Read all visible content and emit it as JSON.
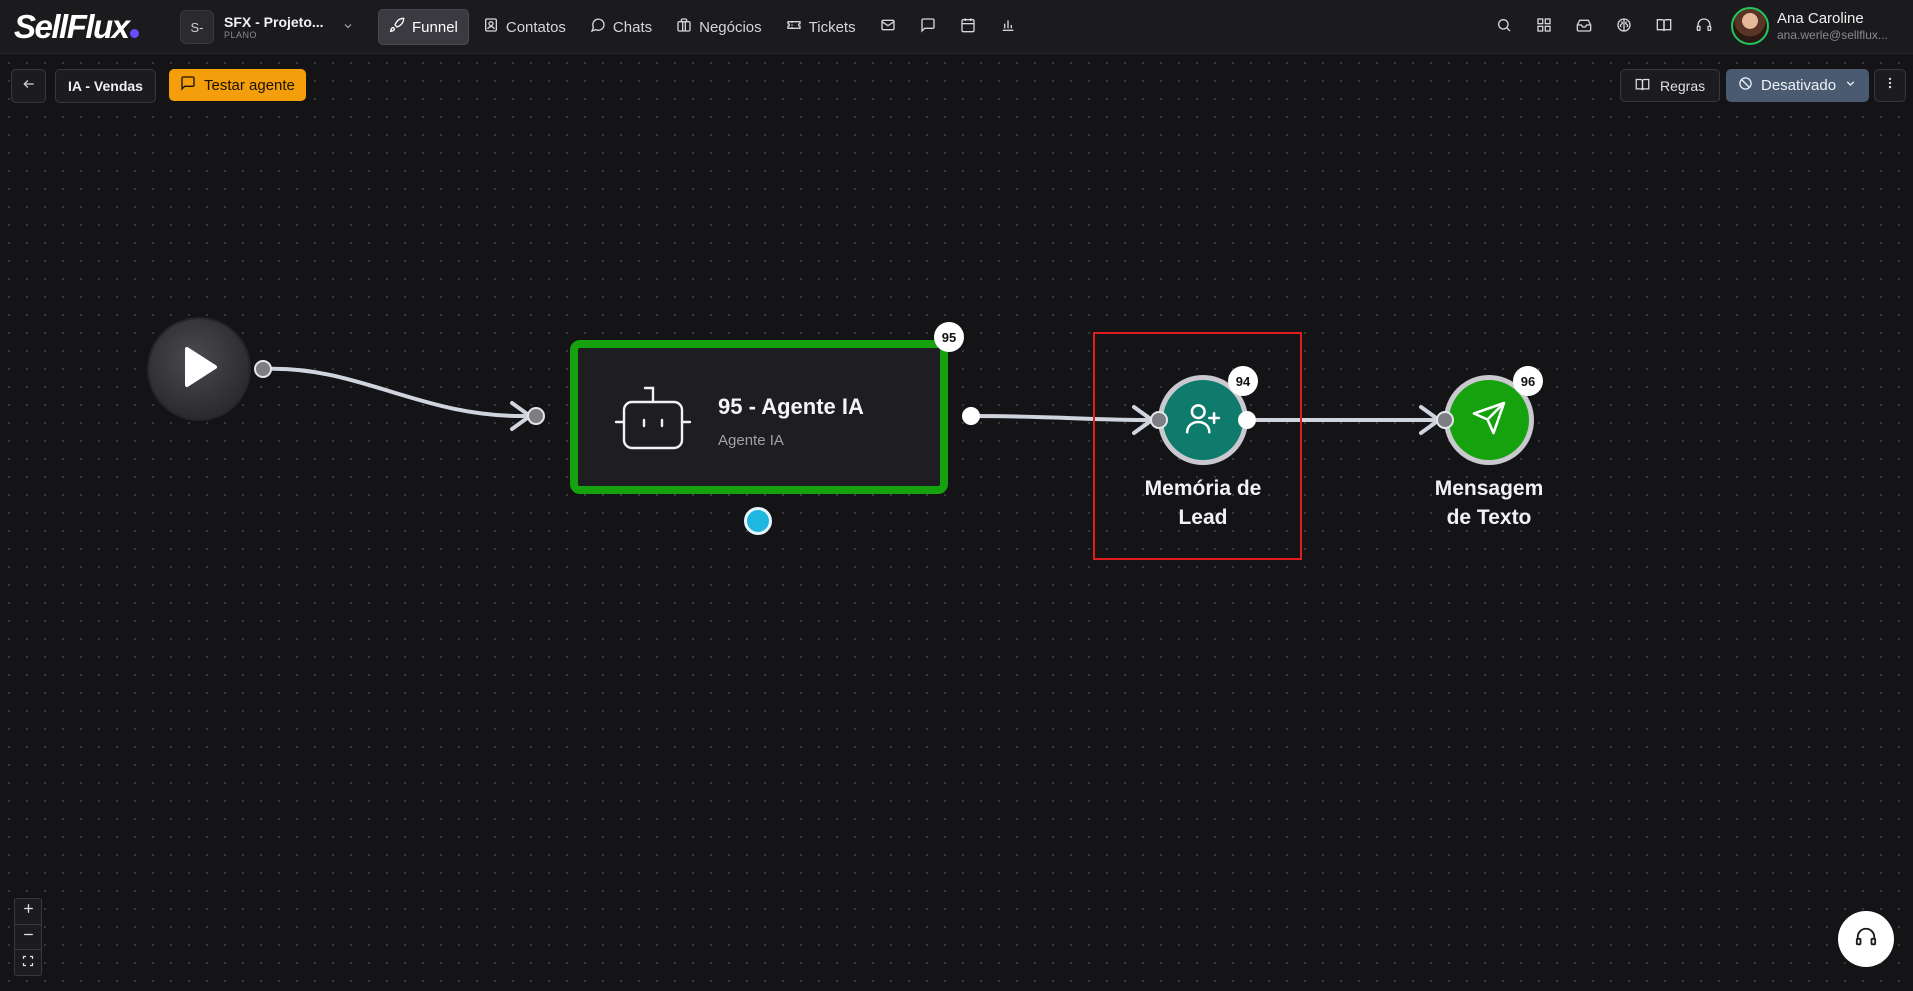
{
  "app": {
    "logo_text": "SellFlux"
  },
  "project": {
    "avatar_text": "S-",
    "name": "SFX - Projeto...",
    "plan": "PLANO"
  },
  "nav": {
    "items": [
      {
        "label": "Funnel",
        "icon": "rocket-icon",
        "active": true
      },
      {
        "label": "Contatos",
        "icon": "contacts-icon"
      },
      {
        "label": "Chats",
        "icon": "chat-bubble-icon"
      },
      {
        "label": "Negócios",
        "icon": "briefcase-icon"
      },
      {
        "label": "Tickets",
        "icon": "ticket-icon"
      }
    ],
    "icon_items": [
      "mail-icon",
      "message-square-icon",
      "calendar-icon",
      "bar-chart-icon"
    ]
  },
  "header_right": {
    "icons": [
      "search-icon",
      "apps-grid-icon",
      "inbox-icon",
      "brain-icon",
      "book-open-icon",
      "headset-icon"
    ]
  },
  "user": {
    "name": "Ana Caroline",
    "email": "ana.werle@sellflux..."
  },
  "toolbar": {
    "flow_name": "IA - Vendas",
    "test_agent_label": "Testar agente",
    "rules_label": "Regras",
    "status_label": "Desativado"
  },
  "canvas": {
    "agent_node": {
      "badge": "95",
      "title": "95 - Agente IA",
      "subtitle": "Agente IA",
      "icon": "robot-icon"
    },
    "memory_node": {
      "badge": "94",
      "label_line1": "Memória de",
      "label_line2": "Lead",
      "icon": "user-plus-icon",
      "color": "#0f7b6c"
    },
    "message_node": {
      "badge": "96",
      "label_line1": "Mensagem",
      "label_line2": "de Texto",
      "icon": "send-icon",
      "color": "#16a10e"
    }
  },
  "colors": {
    "accent_orange": "#f59e0b",
    "agent_border": "#16a10e",
    "selection": "#e11d1d",
    "status_bg": "#4a5a70"
  }
}
